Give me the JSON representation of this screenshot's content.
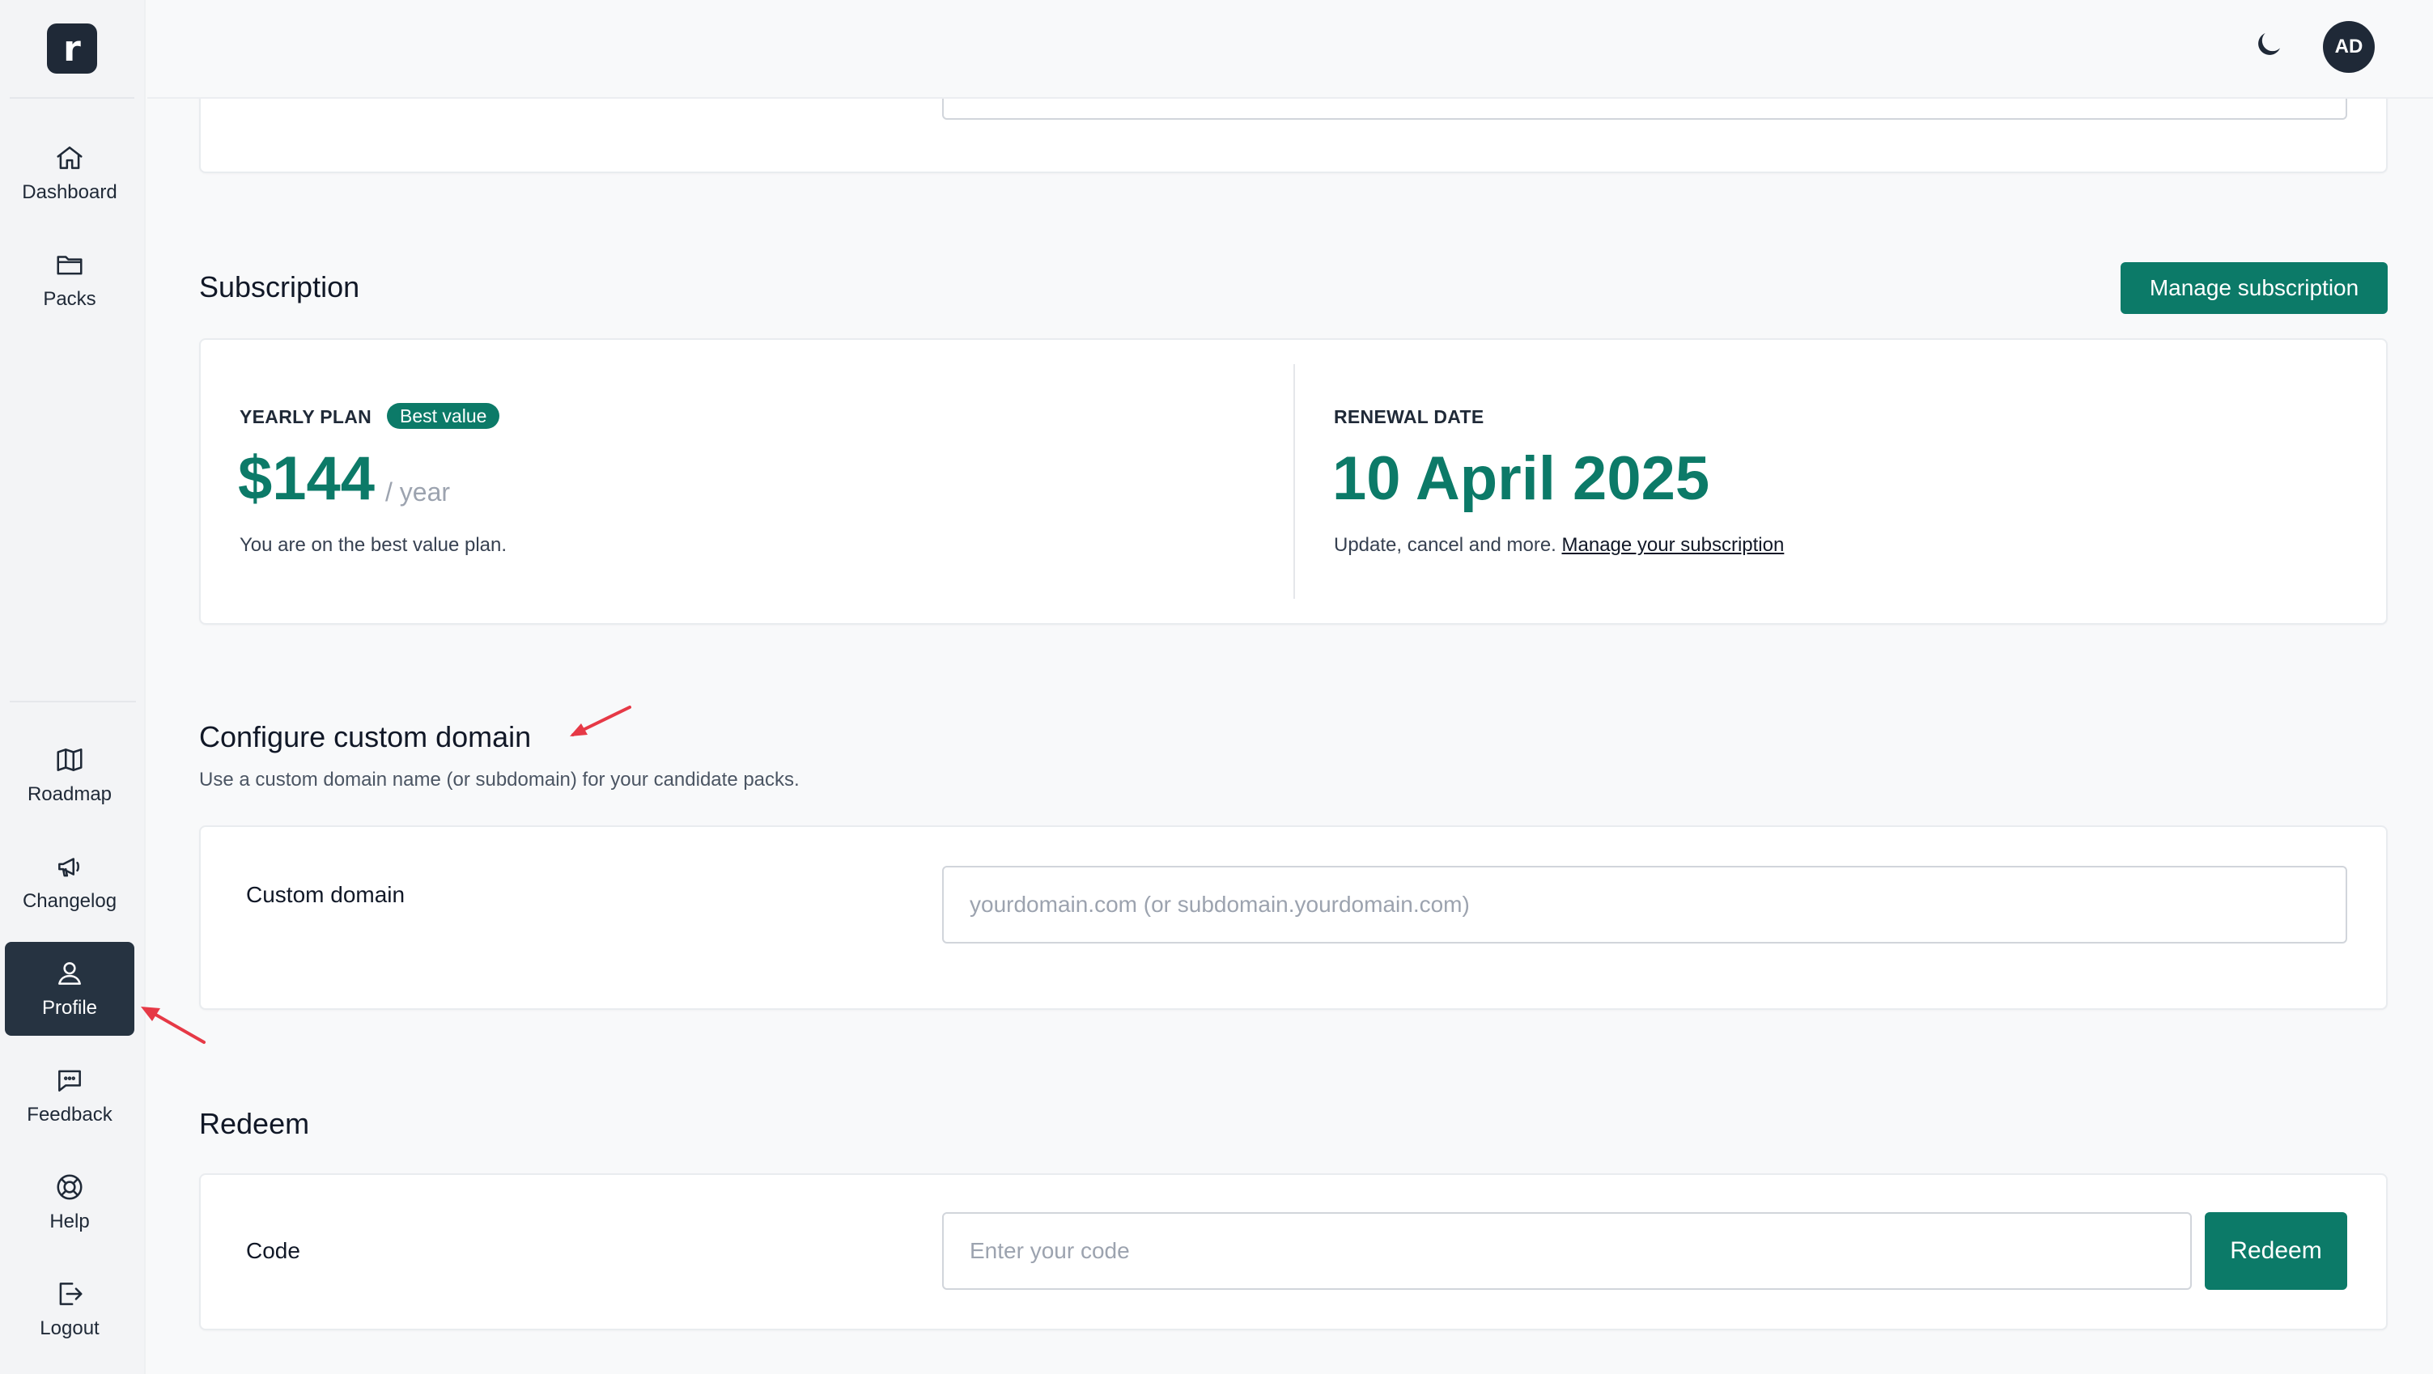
{
  "brand": {
    "logo_letter": "r"
  },
  "sidebar": {
    "top_items": [
      {
        "label": "Dashboard",
        "icon": "home-icon"
      },
      {
        "label": "Packs",
        "icon": "folder-icon"
      }
    ],
    "bottom_items": [
      {
        "label": "Roadmap",
        "icon": "map-icon"
      },
      {
        "label": "Changelog",
        "icon": "megaphone-icon"
      },
      {
        "label": "Profile",
        "icon": "user-icon",
        "active": true
      },
      {
        "label": "Feedback",
        "icon": "chat-icon"
      },
      {
        "label": "Help",
        "icon": "lifebuoy-icon"
      },
      {
        "label": "Logout",
        "icon": "logout-icon"
      }
    ]
  },
  "header": {
    "avatar_initials": "AD",
    "theme_icon": "moon-icon"
  },
  "subscription": {
    "title": "Subscription",
    "manage_button": "Manage subscription",
    "plan_label": "YEARLY PLAN",
    "plan_badge": "Best value",
    "price": "$144",
    "period": "/ year",
    "plan_note": "You are on the best value plan.",
    "renewal_label": "RENEWAL DATE",
    "renewal_date": "10 April 2025",
    "renewal_note": "Update, cancel and more.",
    "renewal_link": "Manage your subscription"
  },
  "custom_domain": {
    "title": "Configure custom domain",
    "description": "Use a custom domain name (or subdomain) for your candidate packs.",
    "field_label": "Custom domain",
    "placeholder": "yourdomain.com (or subdomain.yourdomain.com)"
  },
  "redeem": {
    "title": "Redeem",
    "field_label": "Code",
    "placeholder": "Enter your code",
    "button": "Redeem"
  },
  "colors": {
    "accent": "#0c7a68",
    "sidebar_active": "#263341",
    "annotation_arrow": "#e63946"
  }
}
